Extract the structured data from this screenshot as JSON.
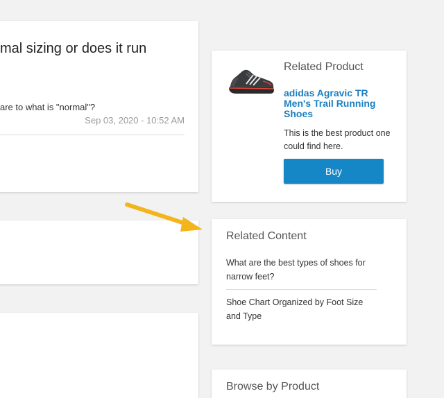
{
  "question": {
    "title": "mal sizing or does it run",
    "text": "are to what is \"normal\"?",
    "date": "Sep 03, 2020 - 10:52 AM"
  },
  "related_product": {
    "heading": "Related Product",
    "name": "adidas Agravic TR Men's Trail Running Shoes",
    "description": "This is the best product one could find here.",
    "buy_label": "Buy",
    "image_icon": "trail-running-shoe"
  },
  "related_content": {
    "heading": "Related Content",
    "items": [
      {
        "label": "What are the best types of shoes for narrow feet?"
      },
      {
        "label": "Shoe Chart Organized by Foot Size and Type"
      }
    ]
  },
  "browse": {
    "heading": "Browse by Product"
  },
  "colors": {
    "accent": "#1586c6",
    "link": "#1a7fc1",
    "arrow": "#f2b51c",
    "background": "#f2f2f2"
  }
}
